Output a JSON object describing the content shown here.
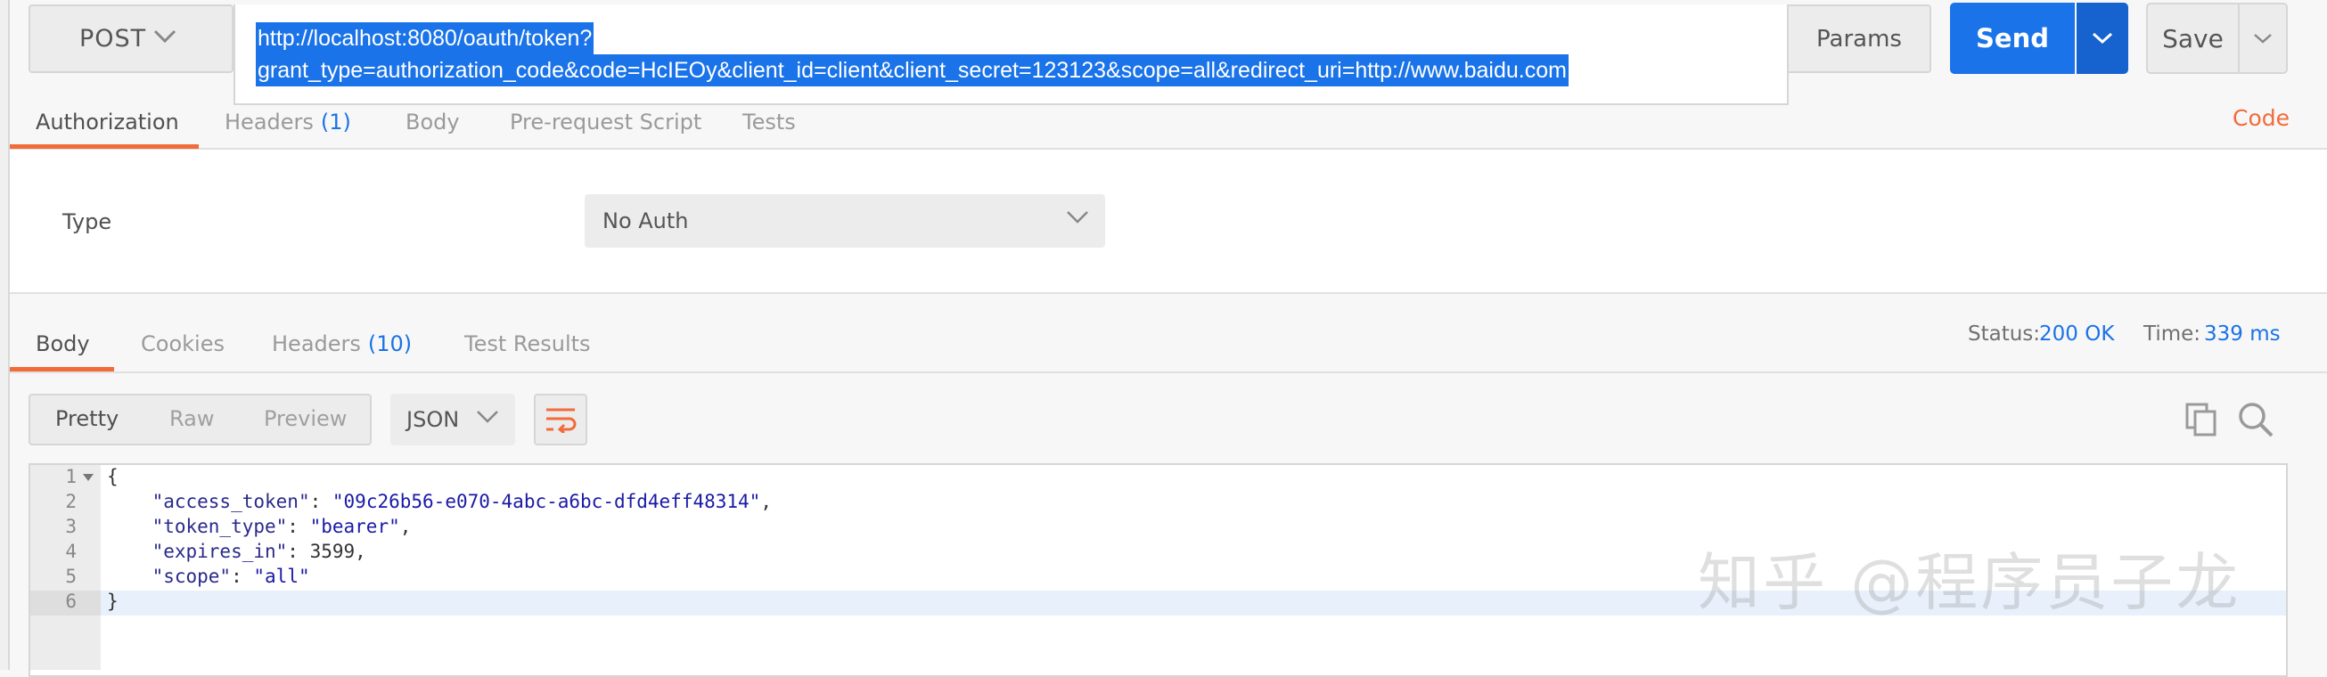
{
  "request": {
    "method": "POST",
    "url_line1": "http://localhost:8080/oauth/token?",
    "url_line2": "grant_type=authorization_code&code=HcIEOy&client_id=client&client_secret=123123&scope=all&redirect_uri=http://www.baidu.com",
    "params_label": "Params",
    "send_label": "Send",
    "save_label": "Save"
  },
  "request_tabs": {
    "authorization": "Authorization",
    "headers": "Headers",
    "headers_count": "(1)",
    "body": "Body",
    "prerequest": "Pre-request Script",
    "tests": "Tests",
    "code_link": "Code"
  },
  "auth": {
    "type_label": "Type",
    "type_value": "No Auth"
  },
  "response_tabs": {
    "body": "Body",
    "cookies": "Cookies",
    "headers": "Headers",
    "headers_count": "(10)",
    "test_results": "Test Results"
  },
  "response_status": {
    "status_label": "Status:",
    "status_value": "200 OK",
    "time_label": "Time:",
    "time_value": "339 ms"
  },
  "view": {
    "pretty": "Pretty",
    "raw": "Raw",
    "preview": "Preview",
    "format": "JSON"
  },
  "editor": {
    "line_numbers": [
      "1",
      "2",
      "3",
      "4",
      "5",
      "6"
    ],
    "open_brace": "{",
    "close_brace": "}",
    "lines": [
      {
        "key": "\"access_token\"",
        "value": "\"09c26b56-e070-4abc-a6bc-dfd4eff48314\"",
        "trail": ","
      },
      {
        "key": "\"token_type\"",
        "value": "\"bearer\"",
        "trail": ","
      },
      {
        "key": "\"expires_in\"",
        "value": "3599",
        "trail": ","
      },
      {
        "key": "\"scope\"",
        "value": "\"all\"",
        "trail": ""
      }
    ]
  },
  "watermark": "知乎 @程序员子龙",
  "colors": {
    "accent_blue": "#1a73e8",
    "accent_orange": "#f26b3a"
  }
}
